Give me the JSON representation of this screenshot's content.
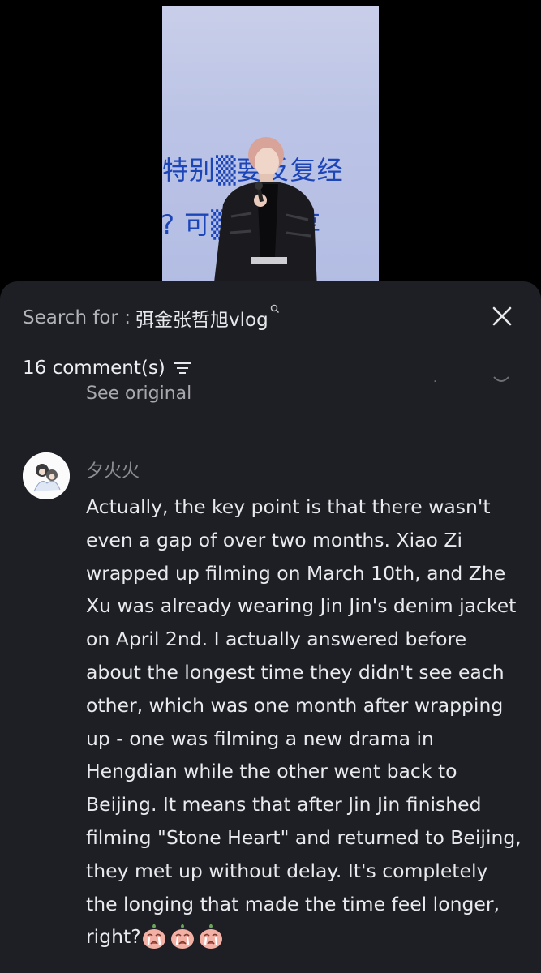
{
  "video": {
    "overlay_line1": "特别▒要反复经",
    "overlay_line2": "? 可▒ 以分享"
  },
  "search": {
    "prefix": "Search for :",
    "query": "弭金张哲旭vlog",
    "query_icon": "search-icon"
  },
  "comments": {
    "count_label": "16 comment(s)",
    "see_original": "See original",
    "items": [
      {
        "username": "夕火火",
        "text": "Actually, the key point is that there wasn't even a gap of over two months. Xiao Zi wrapped up filming on March 10th, and Zhe Xu was already wearing Jin Jin's denim jacket on April 2nd. I actually answered before about the longest time they didn't see each other, which was one month after wrapping up - one was filming a new drama in Hengdian while the other went back to Beijing. It means that after Jin Jin finished filming \"Stone Heart\" and returned to Beijing, they met up without delay. It's completely the longing that made the time feel longer, right?",
        "emoji_count": 3
      }
    ]
  },
  "colors": {
    "sheet_bg": "#1e1f24",
    "text_primary": "#e9eaee",
    "text_secondary": "#8d8e94",
    "overlay_text": "#1c45b8"
  }
}
